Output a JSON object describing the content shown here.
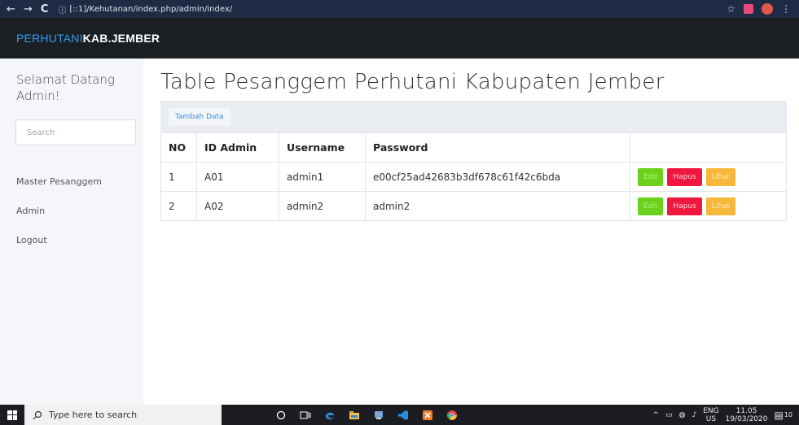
{
  "browser": {
    "back": "←",
    "forward": "→",
    "reload": "C",
    "info": "ⓘ",
    "url": "[::1]/Kehutanan/index.php/admin/index/",
    "star": "☆"
  },
  "navbar": {
    "brand_part1": "PERHUTANI",
    "brand_part2": "KAB.JEMBER"
  },
  "sidebar": {
    "welcome": "Selamat Datang Admin!",
    "search_placeholder": "Search",
    "items": [
      {
        "label": "Master Pesanggem"
      },
      {
        "label": "Admin"
      },
      {
        "label": "Logout"
      }
    ]
  },
  "main": {
    "title": "Table Pesanggem Perhutani Kabupaten Jember",
    "add_button": "Tambah Data",
    "columns": [
      "NO",
      "ID Admin",
      "Username",
      "Password",
      ""
    ],
    "rows": [
      {
        "no": "1",
        "id": "A01",
        "username": "admin1",
        "password": "e00cf25ad42683b3df678c61f42c6bda",
        "edit": "Edit",
        "hapus": "Hapus",
        "lihat": "Lihat"
      },
      {
        "no": "2",
        "id": "A02",
        "username": "admin2",
        "password": "admin2",
        "edit": "Edit",
        "hapus": "Hapus",
        "lihat": "Lihat"
      }
    ]
  },
  "taskbar": {
    "search_placeholder": "Type here to search",
    "tray": {
      "lang1": "ENG",
      "lang2": "US",
      "time": "11.05",
      "date": "19/03/2020",
      "notif_count": "10"
    }
  },
  "colors": {
    "brand_accent": "#2c9ff2",
    "edit": "#6bd11c",
    "hapus": "#f0173f",
    "lihat": "#f6b83a"
  }
}
